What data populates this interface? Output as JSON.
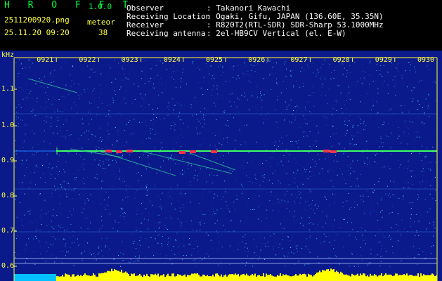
{
  "header": {
    "app_title": "H R O F F T",
    "version": "1.0.0",
    "filename": "2511200920.png",
    "timestamp": "25.11.20 09:20",
    "meteor_label": "meteor",
    "meteor_count": "38",
    "observer_label": "Observer",
    "observer_value": ": Takanori Kawachi",
    "location_label": "Receiving Location",
    "location_value": ": Ogaki, Gifu, JAPAN (136.60E, 35.35N)",
    "receiver_label": "Receiver",
    "receiver_value": ": R820T2(RTL-SDR) SDR-Sharp 53.1000MHz",
    "antenna_label": "Receiving antenna",
    "antenna_value": ": 2el-HB9CV Vertical (el. E-W)"
  },
  "axis": {
    "unit": "kHz",
    "y_ticks": [
      "1.1",
      "1.0",
      "0.9",
      "0.8",
      "0.7",
      "0.6"
    ],
    "time_ticks": [
      "0921",
      "0922",
      "0923",
      "0924",
      "0925",
      "0926",
      "0927",
      "0928",
      "0929",
      "0930"
    ]
  },
  "colors": {
    "background": "#0a1a8a",
    "carrier": "#40ff60",
    "echo": "#ff3050",
    "level_bar": "#ffff00",
    "level_low": "#00c0ff",
    "label_yellow": "#ffff40",
    "label_green": "#00ff40"
  }
}
